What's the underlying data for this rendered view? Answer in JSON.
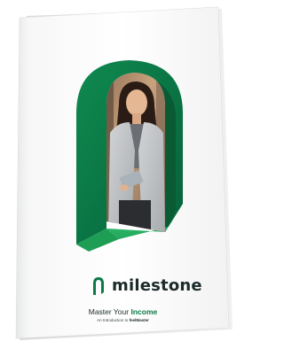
{
  "cover": {
    "brand": "milestone",
    "headline_prefix": "Master Your",
    "headline_emphasis": "Income",
    "subline_prefix": "An Introduction to",
    "subline_brand": "feelMaster"
  },
  "icons": {
    "logo": "arch-logo-icon"
  },
  "colors": {
    "arch_dark": "#0c7a46",
    "arch_light": "#2fbb6a",
    "arch_inner": "#0a5a34",
    "brand_text": "#1c2a2a",
    "accent": "#0a7a44"
  }
}
